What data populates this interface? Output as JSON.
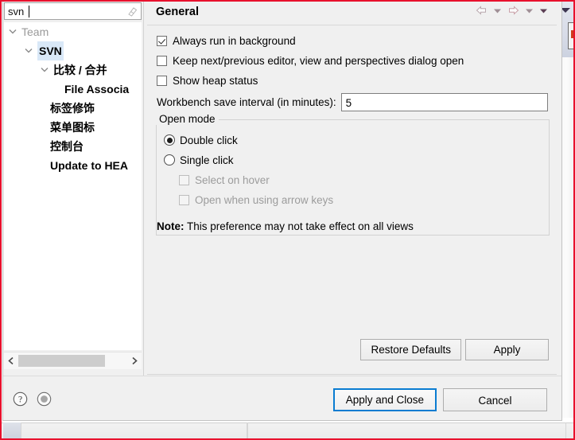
{
  "dialog": {
    "filter": {
      "value": "svn",
      "placeholder": "type filter text",
      "clear_icon": "erase-icon"
    },
    "tree": {
      "items": [
        {
          "label": "Team",
          "indent": 22,
          "twisty": true,
          "style": "grey",
          "highlight": false
        },
        {
          "label": "SVN",
          "indent": 42,
          "twisty": true,
          "style": "bold",
          "highlight": true
        },
        {
          "label": "比较 / 合并",
          "indent": 62,
          "twisty": true,
          "style": "bold",
          "highlight": false
        },
        {
          "label": "File Associa",
          "indent": 76,
          "twisty": false,
          "style": "bold",
          "highlight": false
        },
        {
          "label": "标签修饰",
          "indent": 58,
          "twisty": false,
          "style": "bold",
          "highlight": false
        },
        {
          "label": "菜单图标",
          "indent": 58,
          "twisty": false,
          "style": "bold",
          "highlight": false
        },
        {
          "label": "控制台",
          "indent": 58,
          "twisty": false,
          "style": "bold",
          "highlight": false
        },
        {
          "label": "Update to HEA",
          "indent": 58,
          "twisty": false,
          "style": "bold",
          "highlight": false
        }
      ]
    },
    "hscroll": {
      "left_arrow": "chevron-left-icon",
      "right_arrow": "chevron-right-icon"
    },
    "pane": {
      "title": "General",
      "nav": {
        "back_icon": "back-arrow-icon",
        "back_caret_icon": "chevron-down-icon",
        "forward_icon": "forward-arrow-icon",
        "forward_caret_icon": "chevron-down-icon",
        "menu_caret_icon": "chevron-down-icon"
      },
      "checkboxes": [
        {
          "label": "Always run in background",
          "checked": true,
          "disabled": false
        },
        {
          "label": "Keep next/previous editor, view and perspectives dialog open",
          "checked": false,
          "disabled": false
        },
        {
          "label": "Show heap status",
          "checked": false,
          "disabled": false
        }
      ],
      "interval": {
        "label": "Workbench save interval (in minutes):",
        "value": "5"
      },
      "open_mode": {
        "title": "Open mode",
        "radios": [
          {
            "label": "Double click",
            "selected": true
          },
          {
            "label": "Single click",
            "selected": false
          }
        ],
        "sub_checkboxes": [
          {
            "label": "Select on hover",
            "checked": false,
            "disabled": true
          },
          {
            "label": "Open when using arrow keys",
            "checked": false,
            "disabled": true
          }
        ],
        "note_prefix": "Note:",
        "note_text": " This preference may not take effect on all views"
      },
      "buttons": {
        "restore_defaults": "Restore Defaults",
        "apply": "Apply"
      }
    },
    "bottom": {
      "help_icon": "help-icon",
      "restore_icon": "restore-window-icon",
      "apply_and_close": "Apply and Close",
      "cancel": "Cancel"
    }
  },
  "colors": {
    "accent": "#0a7cd1",
    "highlight": "#d9e8f7",
    "annotation_border": "#e8112d",
    "dialog_bg": "#f0f0f0",
    "field_bg": "#ffffff"
  }
}
